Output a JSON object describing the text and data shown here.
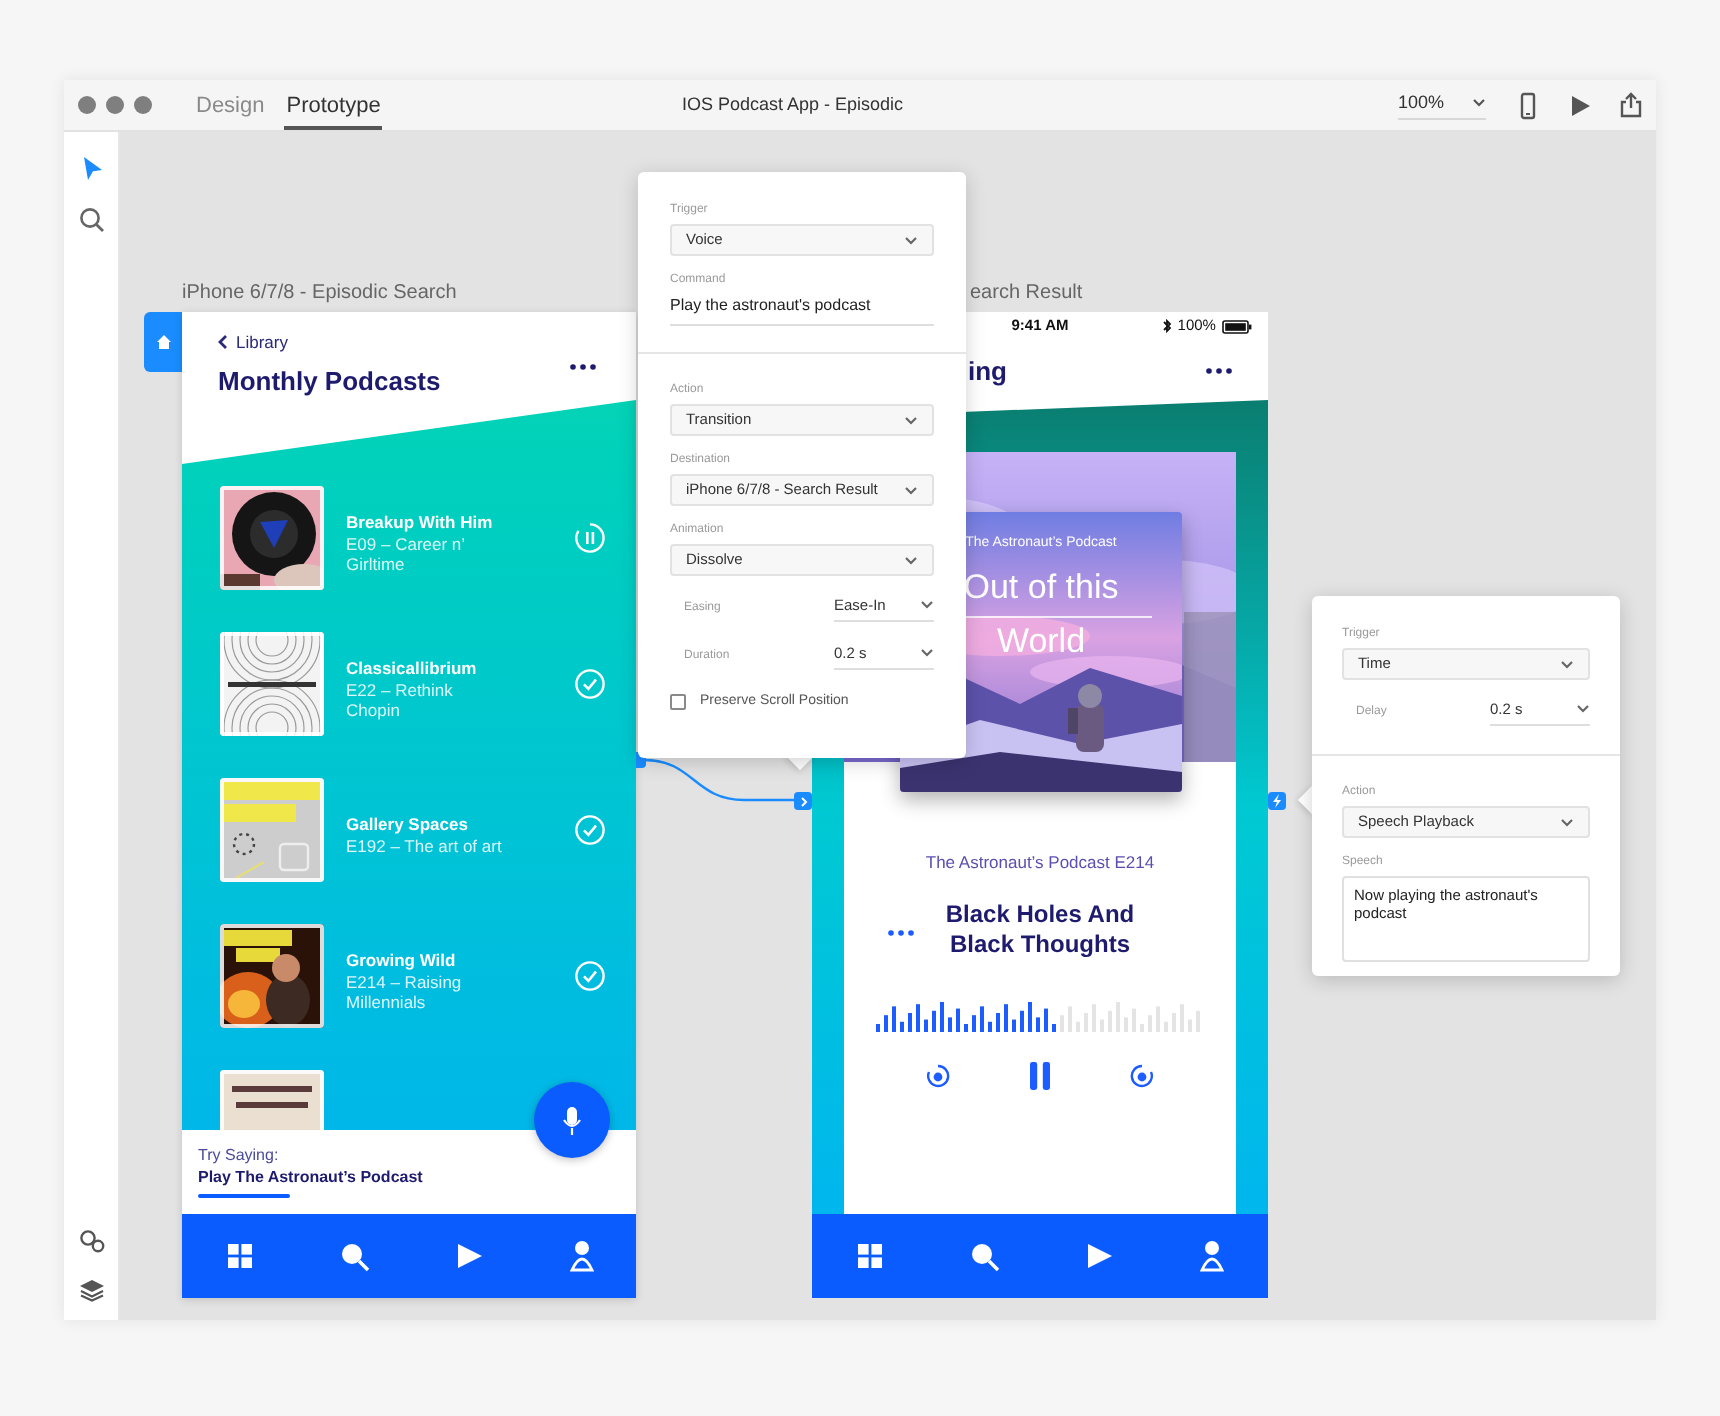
{
  "window": {
    "title": "IOS Podcast App - Episodic"
  },
  "mode_tabs": [
    {
      "label": "Design",
      "selected": false
    },
    {
      "label": "Prototype",
      "selected": true
    }
  ],
  "zoom_select": {
    "value": "100%"
  },
  "tools": [
    {
      "kind": "select",
      "selected": true
    },
    {
      "kind": "search",
      "selected": false
    }
  ],
  "search_artboard": {
    "label": "iPhone 6/7/8 - Episodic Search",
    "back": "Library",
    "title": "Monthly Podcasts",
    "episodes": [
      {
        "title": "Breakup With Him",
        "lines": [
          "E09 – Career n’",
          "Girltime"
        ],
        "kind": "playing"
      },
      {
        "title": "Classicallibrium",
        "lines": [
          "E22 – Rethink",
          "Chopin"
        ],
        "kind": "played"
      },
      {
        "title": "Gallery Spaces",
        "lines": [
          "E192 – The art of art"
        ],
        "kind": "played"
      },
      {
        "title": "Growing Wild",
        "lines": [
          "E214 – Raising",
          "Millennials"
        ],
        "kind": "played"
      }
    ],
    "prompt": {
      "label": "Try Saying:",
      "command": "Play The Astronaut’s Podcast"
    }
  },
  "result_artboard": {
    "label": "earch Result",
    "time": "9:41 AM",
    "battery": "100%",
    "title": "ing",
    "cover": {
      "series": "The Astronaut’s Podcast",
      "title_lines": [
        "Out of this",
        "World"
      ]
    },
    "episode": "The Astronaut’s Podcast E214",
    "episode_title": "Black Holes And Black Thoughts",
    "progress": {
      "level": 0.55
    }
  },
  "voice_popover": {
    "sections": [
      {
        "fields": [
          {
            "kind": "select",
            "label": "Trigger",
            "value": "Voice"
          },
          {
            "kind": "input",
            "label": "Command",
            "value": "Play the astronaut's podcast"
          }
        ]
      },
      {
        "fields": [
          {
            "kind": "select",
            "label": "Action",
            "value": "Transition"
          },
          {
            "kind": "select",
            "label": "Destination",
            "value": "iPhone 6/7/8 - Search Result"
          },
          {
            "kind": "select",
            "label": "Animation",
            "value": "Dissolve"
          },
          {
            "kind": "inline_select",
            "label": "Easing",
            "value": "Ease-In"
          },
          {
            "kind": "inline_select",
            "label": "Duration",
            "value": "0.2 s"
          },
          {
            "kind": "checkbox",
            "label": "Preserve Scroll Position",
            "checked": false
          }
        ]
      }
    ]
  },
  "time_popover": {
    "sections": [
      {
        "fields": [
          {
            "kind": "select",
            "label": "Trigger",
            "value": "Time"
          },
          {
            "kind": "inline_select",
            "label": "Delay",
            "value": "0.2 s"
          }
        ]
      },
      {
        "fields": [
          {
            "kind": "select",
            "label": "Action",
            "value": "Speech Playback"
          },
          {
            "kind": "textarea",
            "label": "Speech",
            "value": "Now playing the astronaut's podcast"
          }
        ]
      }
    ]
  }
}
